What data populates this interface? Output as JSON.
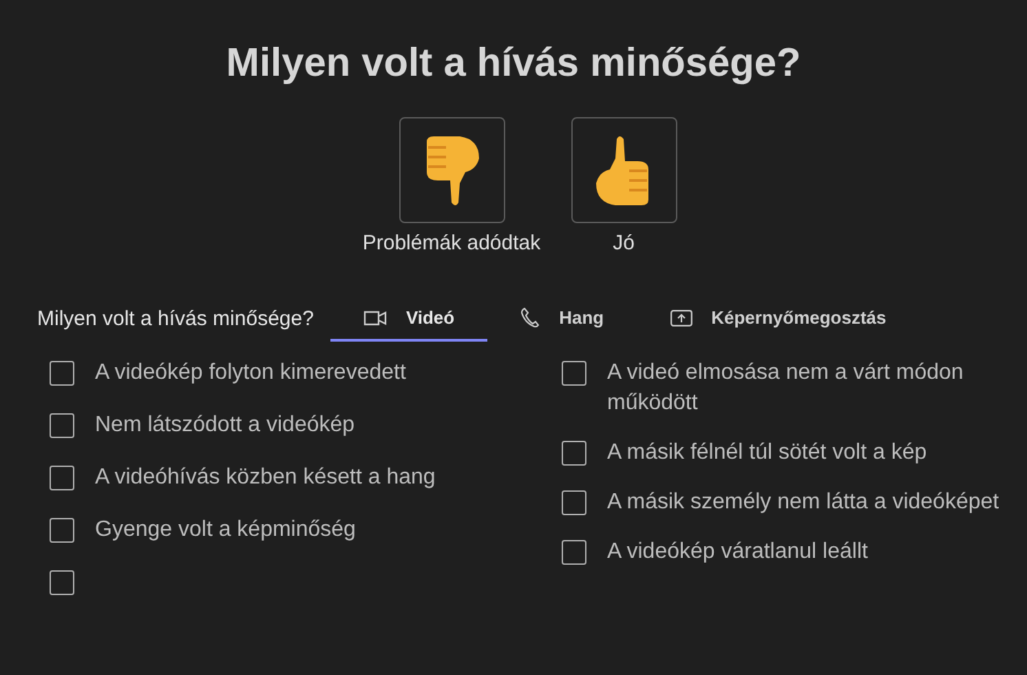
{
  "title": "Milyen volt a hívás minősége?",
  "ratings": [
    {
      "kind": "thumbs-down",
      "label": "Problémák adódtak",
      "selected": false
    },
    {
      "kind": "thumbs-up",
      "label": "Jó",
      "selected": false
    }
  ],
  "issues_label": "Milyen volt a hívás minősége?",
  "tabs": [
    {
      "kind": "video",
      "label": "Videó",
      "selected": true
    },
    {
      "kind": "phone",
      "label": "Hang",
      "selected": false
    },
    {
      "kind": "share",
      "label": "Képernyőmegosztás",
      "selected": false
    }
  ],
  "issues_left": [
    {
      "label": "A videókép folyton kimerevedett",
      "checked": false
    },
    {
      "label": "Nem látszódott a videókép",
      "checked": false
    },
    {
      "label": "A videóhívás közben késett a hang",
      "checked": false
    },
    {
      "label": "Gyenge volt a képminőség",
      "checked": false
    },
    {
      "checked": false
    }
  ],
  "issues_right": [
    {
      "label": "A videó elmosása nem a várt módon működött",
      "checked": false
    },
    {
      "label": "A másik félnél túl sötét volt a kép",
      "checked": false
    },
    {
      "label": "A másik személy nem látta a videóképet",
      "checked": false
    },
    {
      "label": "A videókép váratlanul leállt",
      "checked": false
    }
  ]
}
